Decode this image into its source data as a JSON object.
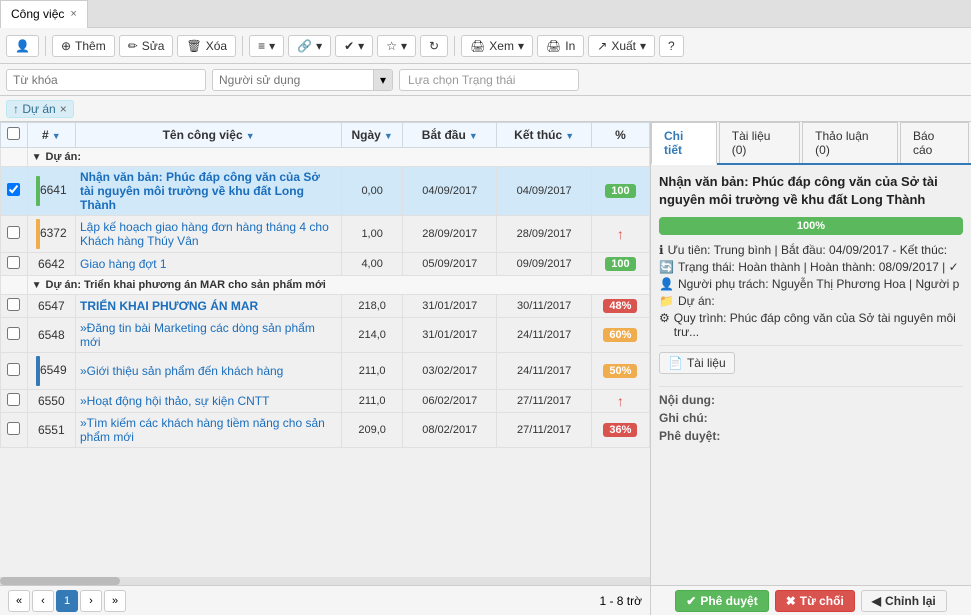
{
  "tab": {
    "label": "Công việc",
    "close": "×"
  },
  "toolbar": {
    "logo": "👤",
    "add": "Thêm",
    "edit": "Sửa",
    "delete": "Xóa",
    "menu": "",
    "link": "",
    "check": "",
    "star": "",
    "refresh": "",
    "view": "Xem",
    "print": "In",
    "export": "Xuất",
    "help": "?"
  },
  "filter": {
    "keyword_placeholder": "Từ khóa",
    "user_placeholder": "Người sử dụng",
    "state_placeholder": "Lựa chọn Trạng thái"
  },
  "tag": {
    "label": "↑ Dự án",
    "close": "×"
  },
  "table": {
    "headers": [
      "#",
      "Tên công việc",
      "Ngày",
      "Bắt đầu",
      "Kết thúc",
      "%"
    ],
    "group1": "Dự án:",
    "group2": "Dự án: Triển khai phương án MAR cho sản phẩm mới",
    "rows": [
      {
        "id": "6641",
        "name": "Nhận văn bản: Phúc đáp công văn của Sở tài nguyên môi trường về khu đất Long Thành",
        "day": "0,00",
        "start": "04/09/2017",
        "end": "04/09/2017",
        "pct": "100",
        "pct_type": "green",
        "bold": true,
        "selected": true,
        "bar_color": "green"
      },
      {
        "id": "6372",
        "name": "Lập kế hoạch giao hàng đơn hàng tháng 4 cho Khách hàng Thúy Vân",
        "day": "1,00",
        "start": "28/09/2017",
        "end": "28/09/2017",
        "pct": "↑",
        "pct_type": "arrow",
        "bold": false,
        "selected": false,
        "bar_color": "yellow"
      },
      {
        "id": "6642",
        "name": "Giao hàng đợt 1",
        "day": "4,00",
        "start": "05/09/2017",
        "end": "09/09/2017",
        "pct": "100",
        "pct_type": "green",
        "bold": false,
        "selected": false,
        "bar_color": ""
      },
      {
        "id": "6547",
        "name": "TRIỂN KHAI PHƯƠNG ÁN MAR",
        "day": "218,0",
        "start": "31/01/2017",
        "end": "30/11/2017",
        "pct": "48%",
        "pct_type": "red",
        "bold": true,
        "selected": false,
        "bar_color": ""
      },
      {
        "id": "6548",
        "name": "»Đăng tin bài Marketing các dòng sản phẩm mới",
        "day": "214,0",
        "start": "31/01/2017",
        "end": "24/11/2017",
        "pct": "60%",
        "pct_type": "orange",
        "bold": false,
        "selected": false,
        "bar_color": ""
      },
      {
        "id": "6549",
        "name": "»Giới thiệu sản phẩm đến khách hàng",
        "day": "211,0",
        "start": "03/02/2017",
        "end": "24/11/2017",
        "pct": "50%",
        "pct_type": "orange",
        "bold": false,
        "selected": false,
        "bar_color": "blue"
      },
      {
        "id": "6550",
        "name": "»Hoạt động hội thảo, sự kiện CNTT",
        "day": "211,0",
        "start": "06/02/2017",
        "end": "27/11/2017",
        "pct": "↑",
        "pct_type": "arrow",
        "bold": false,
        "selected": false,
        "bar_color": ""
      },
      {
        "id": "6551",
        "name": "»Tìm kiếm các khách hàng tiềm năng cho sản phẩm mới",
        "day": "209,0",
        "start": "08/02/2017",
        "end": "27/11/2017",
        "pct": "36%",
        "pct_type": "red",
        "bold": false,
        "selected": false,
        "bar_color": ""
      }
    ],
    "pagination": "1 - 8 trờ"
  },
  "detail": {
    "tabs": [
      "Chi tiết",
      "Tài liệu (0)",
      "Thảo luận (0)",
      "Báo cáo"
    ],
    "title": "Nhận văn bản: Phúc đáp công văn của Sở tài nguyên môi trường về khu đất Long Thành",
    "progress": 100,
    "progress_text": "100%",
    "info1": "Ưu tiên: Trung bình  |  Bắt đầu: 04/09/2017 - Kết thúc:",
    "info2": "Trạng thái: Hoàn thành  |  Hoàn thành: 08/09/2017  |  ✓",
    "info3": "Người phụ trách: Nguyễn Thị Phương Hoa  |  Người p",
    "info4": "Dự án:",
    "info5": "Quy trình: Phúc đáp công văn của Sở tài nguyên môi trư...",
    "doc_btn": "Tài liệu",
    "content_label": "Nội dung:",
    "note_label": "Ghi chú:",
    "approve_label": "Phê duyệt:"
  },
  "actions": {
    "approve": "Phê duyệt",
    "reject": "Từ chối",
    "correct": "Chỉnh lại"
  }
}
